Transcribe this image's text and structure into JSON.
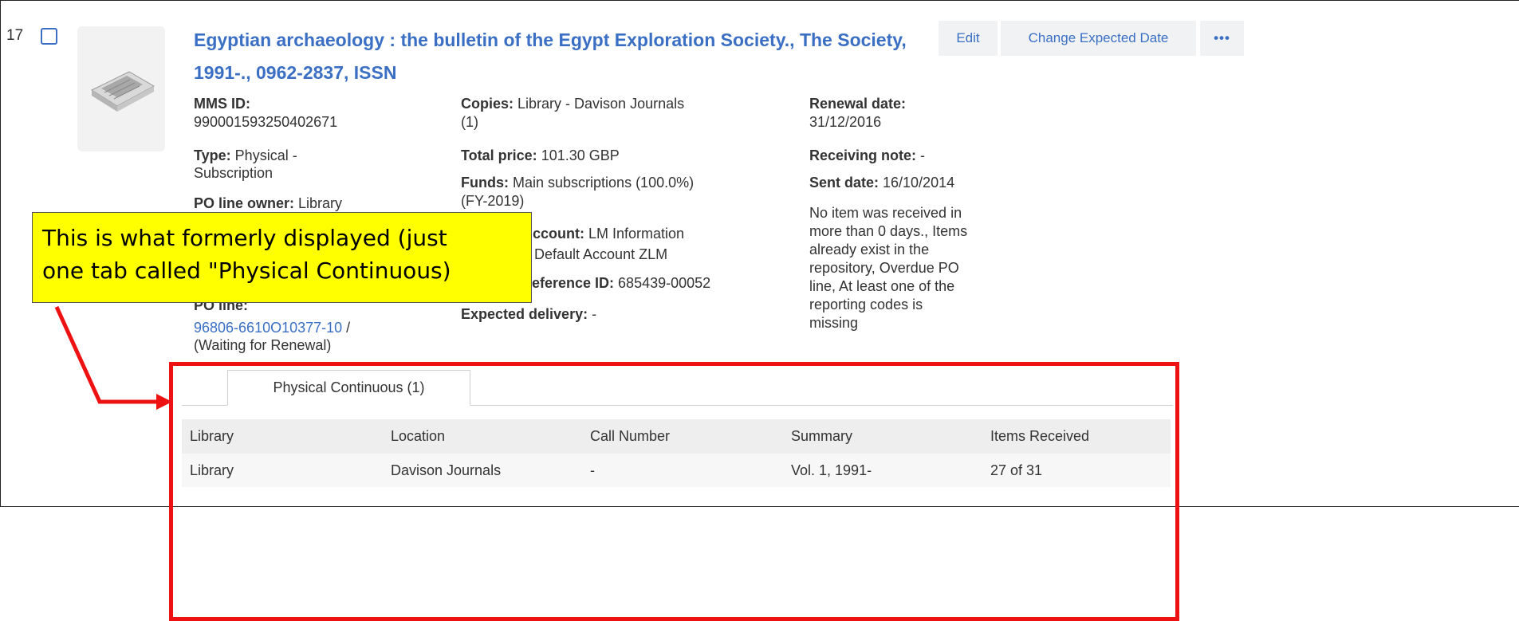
{
  "record": {
    "index": "17",
    "title": "Egyptian archaeology : the bulletin of the Egypt Exploration Society., The Society, 1991-., 0962-2837, ISSN",
    "actions": {
      "edit": "Edit",
      "change_expected_date": "Change Expected Date",
      "more": "•••"
    },
    "col1": {
      "mms_label": "MMS ID:",
      "mms_value": "990001593250402671",
      "type_label": "Type:",
      "type_value": " Physical -",
      "type_value2": "Subscription",
      "owner_label": "PO line owner:",
      "owner_value": " Library",
      "po_line_label": "PO line:",
      "po_line_link": "96806-6610O10377-10",
      "po_line_sep": " /",
      "po_line_status": "(Waiting for Renewal)"
    },
    "col2": {
      "copies_label": "Copies:",
      "copies_value": " Library - Davison Journals",
      "copies_value2": "(1)",
      "price_label": "Total price:",
      "price_value": " 101.30 GBP",
      "funds_label": "Funds:",
      "funds_value": " Main subscriptions (100.0%)",
      "funds_value2": "(FY-2019)",
      "account_label": "ccount:",
      "account_value": " LM Information",
      "account_value2": "Default Account ZLM",
      "reference_label": "eference ID:",
      "reference_value": " 685439-00052",
      "expected_label": "Expected delivery:",
      "expected_value": " -"
    },
    "col3": {
      "renewal_label": "Renewal date:",
      "renewal_value": "31/12/2016",
      "receiving_label": "Receiving note:",
      "receiving_value": " -",
      "sent_label": "Sent date:",
      "sent_value": " 16/10/2014",
      "alert_lines": [
        "No item was received in",
        "more than 0 days., Items",
        "already exist in the",
        "repository, Overdue PO",
        "line, At least one of the",
        "reporting codes is",
        "missing"
      ]
    }
  },
  "callout": {
    "line1": "This is what formerly displayed (just",
    "line2": "one tab called \"Physical Continuous)"
  },
  "tabs": [
    {
      "label": "Physical Continuous (1)"
    }
  ],
  "table": {
    "headers": [
      "Library",
      "Location",
      "Call Number",
      "Summary",
      "Items Received"
    ],
    "rows": [
      [
        "Library",
        "Davison Journals",
        "-",
        "Vol. 1, 1991-",
        "27 of 31"
      ]
    ]
  },
  "colors": {
    "link": "#3a6fc4",
    "callout_bg": "#ffff00",
    "annotation_red": "#ee1111"
  }
}
